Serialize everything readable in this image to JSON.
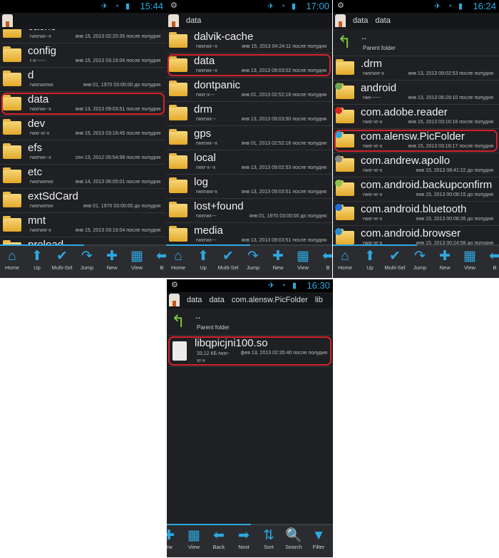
{
  "colors": {
    "accent": "#2fa8e0",
    "highlight": "#d4212b",
    "folder": "#f0c050"
  },
  "panels": [
    {
      "time": "15:44",
      "crumbs": [],
      "parent": null,
      "offset": -14,
      "rows": [
        {
          "name": "cache",
          "perm": "rwxrwx--x",
          "date": "янв 15, 2013 02:20:35 после полудня"
        },
        {
          "name": "config",
          "perm": "r-x------",
          "date": "янв 15, 2013 03:16:04 после полудня"
        },
        {
          "name": "d",
          "perm": "rwxrwxrwx",
          "date": "янв 01, 1970 03:00:00 до полудня"
        },
        {
          "name": "data",
          "perm": "rwxrwx--x",
          "date": "янв 13, 2013 09:03:51 после полудня",
          "highlight": true
        },
        {
          "name": "dev",
          "perm": "rwxr-xr-x",
          "date": "янв 15, 2013 03:16:45 после полудня"
        },
        {
          "name": "efs",
          "perm": "rwxrwx--x",
          "date": "сен 13, 2012 05:54:58 после полудня"
        },
        {
          "name": "etc",
          "perm": "rwxrwxrwx",
          "date": "янв 14, 2013 06:05:01 после полудня"
        },
        {
          "name": "extSdCard",
          "perm": "rwxrwxrwx",
          "date": "янв 01, 1970 03:00:00 до полудня"
        },
        {
          "name": "mnt",
          "perm": "rwxrwxr-x",
          "date": "янв 15, 2013 03:16:04 после полудня"
        },
        {
          "name": "preload",
          "perm": "",
          "date": ""
        }
      ],
      "toolbar": [
        {
          "icon": "home-icon",
          "label": "Home"
        },
        {
          "icon": "up-arrow-icon",
          "label": "Up"
        },
        {
          "icon": "checkmark-icon",
          "label": "Multi-Sel"
        },
        {
          "icon": "jump-arrow-icon",
          "label": "Jump"
        },
        {
          "icon": "plus-icon",
          "label": "New"
        },
        {
          "icon": "grid-icon",
          "label": "View"
        },
        {
          "icon": "back-arrow-icon",
          "label": "B"
        }
      ]
    },
    {
      "time": "17:00",
      "crumbs": [
        "data"
      ],
      "parent": null,
      "offset": 0,
      "rows": [
        {
          "name": "dalvik-cache",
          "perm": "rwxrwx--x",
          "date": "янв 15, 2013 04:24:11 после полудня"
        },
        {
          "name": "data",
          "perm": "rwxrwx--x",
          "date": "янв 13, 2013 09:03:02 после полудня",
          "highlight": true
        },
        {
          "name": "dontpanic",
          "perm": "rwxr-x---",
          "date": "янв 01, 2013 02:52:16 после полудня"
        },
        {
          "name": "drm",
          "perm": "rwxrwx---",
          "date": "янв 13, 2013 09:03:50 после полудня"
        },
        {
          "name": "gps",
          "perm": "rwxrwx--x",
          "date": "янв 01, 2013 02:52:16 после полудня"
        },
        {
          "name": "local",
          "perm": "rwxr-x--x",
          "date": "янв 13, 2013 09:02:53 после полудня"
        },
        {
          "name": "log",
          "perm": "rwxrwxr-x",
          "date": "янв 13, 2013 09:03:51 после полудня"
        },
        {
          "name": "lost+found",
          "perm": "rwxrwx---",
          "date": "янв 01, 1970 03:00:00 до полудня"
        },
        {
          "name": "media",
          "perm": "rwxrwx---",
          "date": "янв 13, 2013 09:03:51 после полудня"
        }
      ],
      "toolbar": [
        {
          "icon": "home-icon",
          "label": "Home"
        },
        {
          "icon": "up-arrow-icon",
          "label": "Up"
        },
        {
          "icon": "checkmark-icon",
          "label": "Multi-Sel"
        },
        {
          "icon": "jump-arrow-icon",
          "label": "Jump"
        },
        {
          "icon": "plus-icon",
          "label": "New"
        },
        {
          "icon": "grid-icon",
          "label": "View"
        },
        {
          "icon": "back-arrow-icon",
          "label": "B"
        }
      ]
    },
    {
      "time": "16:24",
      "crumbs": [
        "data",
        "data"
      ],
      "parent": {
        "dots": "..",
        "label": "Parent folder"
      },
      "offset": 0,
      "rows": [
        {
          "name": ".drm",
          "perm": "rwxrwxr-x",
          "date": "янв 13, 2013 09:02:53 после полудня"
        },
        {
          "name": "android",
          "perm": "rwx------",
          "date": "янв 13, 2013 06:29:10 после полудня",
          "badge": "#6aa84f"
        },
        {
          "name": "com.adobe.reader",
          "perm": "rwxr-xr-x",
          "date": "янв 15, 2013 03:16:16 после полудня",
          "badge": "#d9251d"
        },
        {
          "name": "com.alensw.PicFolder",
          "perm": "rwxr-xr-x",
          "date": "янв 15, 2013 03:16:17 после полудня",
          "highlight": true,
          "badge": "#2fa8e0"
        },
        {
          "name": "com.andrew.apollo",
          "perm": "rwxr-xr-x",
          "date": "янв 15, 2013 08:41:22 до полудня",
          "badge": "#888888"
        },
        {
          "name": "com.android.backupconfirm",
          "perm": "rwxr-xr-x",
          "date": "янв 15, 2013 00:08:15 до полудня",
          "badge": "#8bc34a"
        },
        {
          "name": "com.android.bluetooth",
          "perm": "rwxr-xr-x",
          "date": "янв 15, 2013 00:08:26 до полудня",
          "badge": "#1e6fd9"
        },
        {
          "name": "com.android.browser",
          "perm": "rwxr-xr-x",
          "date": "янв 15, 2013 00:24:58 до полудня",
          "badge": "#2a8fd0"
        }
      ],
      "toolbar": [
        {
          "icon": "home-icon",
          "label": "Home"
        },
        {
          "icon": "up-arrow-icon",
          "label": "Up"
        },
        {
          "icon": "checkmark-icon",
          "label": "Multi-Sel"
        },
        {
          "icon": "jump-arrow-icon",
          "label": "Jump"
        },
        {
          "icon": "plus-icon",
          "label": "New"
        },
        {
          "icon": "grid-icon",
          "label": "View"
        },
        {
          "icon": "back-arrow-icon",
          "label": "B"
        }
      ]
    },
    {
      "time": "16:30",
      "crumbs": [
        "data",
        "data",
        "com.alensw.PicFolder",
        "lib"
      ],
      "parent": {
        "dots": "..",
        "label": "Parent folder"
      },
      "offset": 0,
      "rows": [
        {
          "name": "libqpicjni100.so",
          "perm": "33,12 КБ rwxr-xr-x",
          "date": "фев 13, 2013 02:35:40 после полудня",
          "highlight": true,
          "file": true
        }
      ],
      "toolbar": [
        {
          "icon": "plus-icon",
          "label": "ew"
        },
        {
          "icon": "grid-icon",
          "label": "View"
        },
        {
          "icon": "back-arrow-icon",
          "label": "Back"
        },
        {
          "icon": "next-arrow-icon",
          "label": "Next"
        },
        {
          "icon": "sort-icon",
          "label": "Sort"
        },
        {
          "icon": "search-icon",
          "label": "Search"
        },
        {
          "icon": "filter-icon",
          "label": "Filter"
        }
      ]
    }
  ]
}
